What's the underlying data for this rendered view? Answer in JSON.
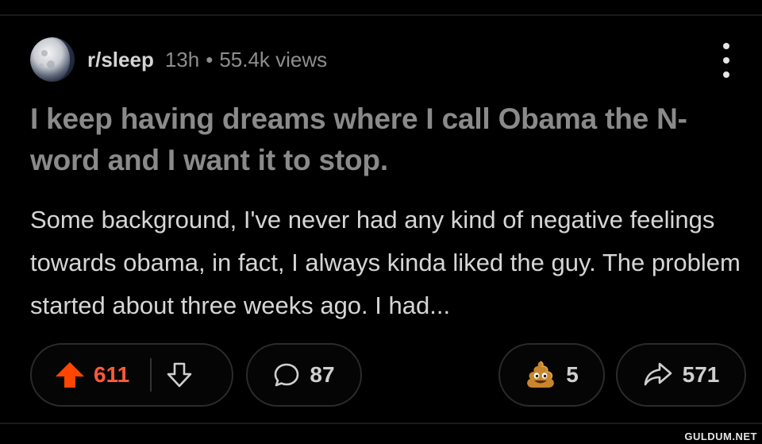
{
  "post": {
    "subreddit": "r/sleep",
    "time": "13h",
    "separator": "•",
    "views": "55.4k views",
    "title": "I keep having dreams where I call Obama the N-word and I want it to stop.",
    "body": "Some background, I've never had any kind of negative feelings towards obama, in fact, I always kinda liked the guy. The problem started about three weeks ago. I had..."
  },
  "actions": {
    "upvotes": "611",
    "comments": "87",
    "awards": "5",
    "shares": "571"
  },
  "icons": {
    "avatar": "moon-avatar",
    "more": "vertical-ellipsis-icon",
    "upvote": "upvote-arrow-icon",
    "downvote": "downvote-arrow-icon",
    "comment": "comment-bubble-icon",
    "award": "poop-emoji-award-icon",
    "share": "share-arrow-icon"
  },
  "colors": {
    "background": "#000000",
    "upvote_active": "#ff5a36",
    "title": "#8a8a8a",
    "body": "#d6d6d6",
    "meta": "#8e8e8e"
  },
  "watermark": "GULDUM.NET"
}
